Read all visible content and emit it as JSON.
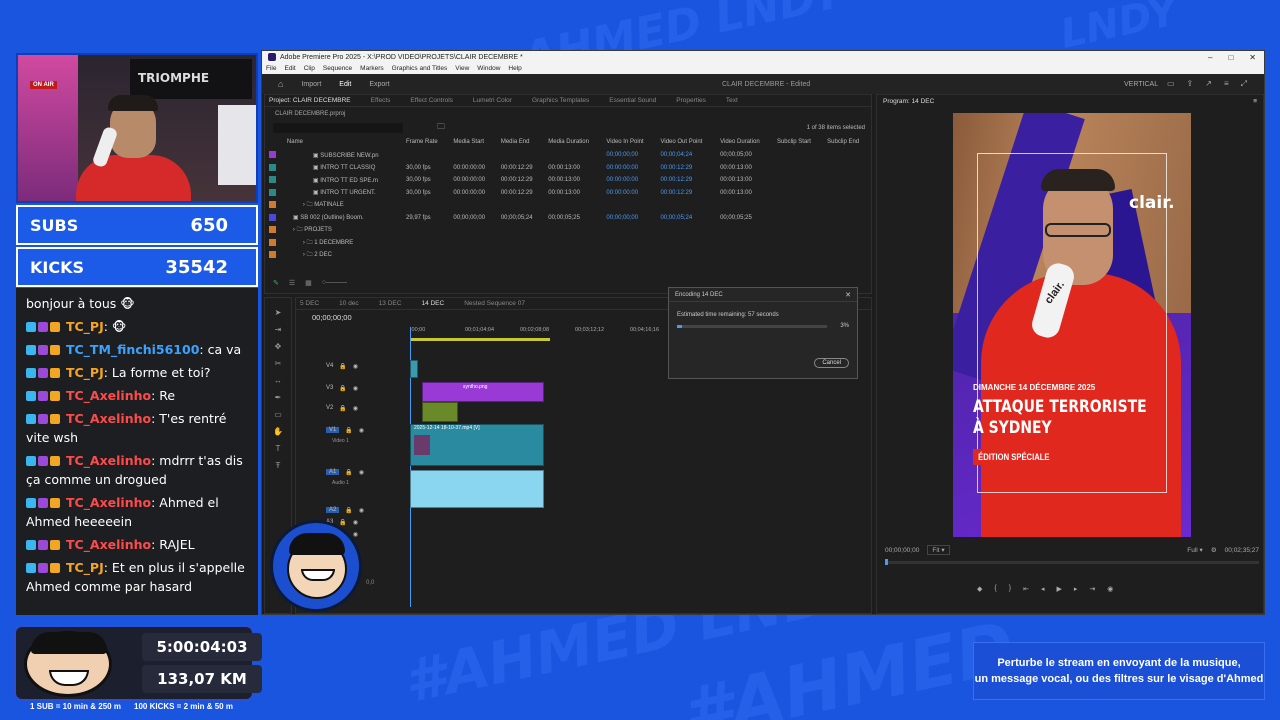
{
  "overlay": {
    "background_text": [
      "AHMED LNDY",
      "#AHMED",
      "LNDY",
      "#AHMED LNDY"
    ],
    "subs_label": "SUBS",
    "subs_value": "650",
    "kicks_label": "KICKS",
    "kicks_value": "35542",
    "timer": "5:00:04:03",
    "distance": "133,07 KM",
    "rule_subs": "1 SUB = 10 min & 250 m",
    "rule_kicks": "100 KICKS = 2 min & 50 m",
    "message_line1": "Perturbe le stream en envoyant de la musique,",
    "message_line2": "un message vocal, ou des filtres sur le visage d'Ahmed",
    "webcam_sign": "TRIOMPHE",
    "webcam_onair": "ON AIR"
  },
  "chat": [
    {
      "user": "",
      "color": "#ffffff",
      "text": "bonjour à tous 🐵",
      "badges": false
    },
    {
      "user": "TC_PJ",
      "color": "#f5a524",
      "text": ": 🐵",
      "badges": true
    },
    {
      "user": "TC_TM_finchi56100",
      "color": "#3aa3ff",
      "text": ": ca va",
      "badges": true
    },
    {
      "user": "TC_PJ",
      "color": "#f5a524",
      "text": ": La forme et toi?",
      "badges": true
    },
    {
      "user": "TC_Axelinho",
      "color": "#ff4a4a",
      "text": ": Re",
      "badges": true
    },
    {
      "user": "TC_Axelinho",
      "color": "#ff4a4a",
      "text": ": T'es rentré vite wsh",
      "badges": true
    },
    {
      "user": "TC_Axelinho",
      "color": "#ff4a4a",
      "text": ": mdrrr t'as dis ça comme un drogued",
      "badges": true
    },
    {
      "user": "TC_Axelinho",
      "color": "#ff4a4a",
      "text": ": Ahmed el Ahmed heeeeein",
      "badges": true
    },
    {
      "user": "TC_Axelinho",
      "color": "#ff4a4a",
      "text": ": RAJEL",
      "badges": true
    },
    {
      "user": "TC_PJ",
      "color": "#f5a524",
      "text": ": Et en plus il s'appelle Ahmed comme par hasard",
      "badges": true
    }
  ],
  "premiere": {
    "window_title": "Adobe Premiere Pro 2025 - X:\\PROD VIDEO\\PROJETS\\CLAIR DECEMBRE *",
    "menu": [
      "File",
      "Edit",
      "Clip",
      "Sequence",
      "Markers",
      "Graphics and Titles",
      "View",
      "Window",
      "Help"
    ],
    "workspace_tabs": [
      "Import",
      "Edit",
      "Export"
    ],
    "doc_title": "CLAIR DECEMBRE - Edited",
    "workspace_label": "VERTICAL",
    "project_tabs": [
      "Project: CLAIR DECEMBRE",
      "Effects",
      "Effect Controls",
      "Lumetri Color",
      "Graphics Templates",
      "Essential Sound",
      "Properties",
      "Text"
    ],
    "project_file": "CLAIR DECEMBRE.prproj",
    "items_selected": "1 of 38 items selected",
    "columns": [
      "Name",
      "Frame Rate",
      "Media Start",
      "Media End",
      "Media Duration",
      "Video In Point",
      "Video Out Point",
      "Video Duration",
      "Subclip Start",
      "Subclip End"
    ],
    "rows": [
      {
        "color": "#9a3ad6",
        "indent": 3,
        "name": "SUBSCRIBE NEW.pn",
        "fr": "",
        "ms": "",
        "me": "",
        "md": "",
        "vi": "00;00;00;00",
        "vo": "00;00;04;24",
        "vd": "00;00;05;00"
      },
      {
        "color": "#2a8a8a",
        "indent": 3,
        "name": "INTRO TT CLASSIQ",
        "fr": "30,00 fps",
        "ms": "00:00:00:00",
        "me": "00:00:12:29",
        "md": "00:00:13:00",
        "vi": "00:00:00:00",
        "vo": "00:00:12:29",
        "vd": "00:00:13:00"
      },
      {
        "color": "#2a8a8a",
        "indent": 3,
        "name": "INTRO TT ED SPE.m",
        "fr": "30,00 fps",
        "ms": "00:00:00:00",
        "me": "00:00:12:29",
        "md": "00:00:13:00",
        "vi": "00:00:00:00",
        "vo": "00:00:12:29",
        "vd": "00:00:13:00"
      },
      {
        "color": "#2a8a8a",
        "indent": 3,
        "name": "INTRO TT URGENT.",
        "fr": "30,00 fps",
        "ms": "00:00:00:00",
        "me": "00:00:12:29",
        "md": "00:00:13:00",
        "vi": "00:00:00:00",
        "vo": "00:00:12:29",
        "vd": "00:00:13:00"
      },
      {
        "color": "#d07a30",
        "indent": 2,
        "name": "MATINALE",
        "fr": "",
        "ms": "",
        "me": "",
        "md": "",
        "vi": "",
        "vo": "",
        "vd": ""
      },
      {
        "color": "#4a4ad6",
        "indent": 1,
        "name": "SB 002 (Outline) Boom.",
        "fr": "29,97 fps",
        "ms": "00;00;00;00",
        "me": "00;00;05;24",
        "md": "00;00;05;25",
        "vi": "00;00;00;00",
        "vo": "00;00;05;24",
        "vd": "00;00;05;25"
      },
      {
        "color": "#d07a30",
        "indent": 1,
        "name": "PROJETS",
        "fr": "",
        "ms": "",
        "me": "",
        "md": "",
        "vi": "",
        "vo": "",
        "vd": ""
      },
      {
        "color": "#d07a30",
        "indent": 2,
        "name": "1 DECEMBRE",
        "fr": "",
        "ms": "",
        "me": "",
        "md": "",
        "vi": "",
        "vo": "",
        "vd": ""
      },
      {
        "color": "#d07a30",
        "indent": 2,
        "name": "2 DEC",
        "fr": "",
        "ms": "",
        "me": "",
        "md": "",
        "vi": "",
        "vo": "",
        "vd": ""
      }
    ],
    "seq_tabs": [
      "5 DEC",
      "10 dec",
      "13 DEC",
      "14 DEC",
      "Nested Sequence 07"
    ],
    "timecode": "00;00;00;00",
    "ruler": [
      ":00;00",
      "00;01;04;04",
      "00;02;08;08",
      "00;03;12;12",
      "00;04;16;16"
    ],
    "tracks": [
      "V4",
      "V3",
      "V2",
      "V1",
      "A1",
      "A2",
      "A3",
      "A4"
    ],
    "track_names": {
      "v1": "Video 1",
      "a1": "Audio 1"
    },
    "clip_png": "syntho.png",
    "clip_mp4": "2025-12-14 18-10-37.mp4 [V]",
    "mix_value": "0,0",
    "dialog_title": "Encoding 14 DEC",
    "dialog_status": "Estimated time remaining: 57 seconds",
    "dialog_percent": "3%",
    "dialog_progress": 0.03,
    "dialog_cancel": "Cancel",
    "program_title": "Program: 14 DEC",
    "program_tc_left": "00;00;00;00",
    "program_fit": "Fit",
    "program_full": "Full",
    "program_tc_right": "00;02;35;27"
  },
  "video": {
    "brand": "clair.",
    "mic_brand": "clair.",
    "date": "DIMANCHE 14 DÉCEMBRE 2025",
    "headline1": "ATTAQUE TERRORISTE",
    "headline2": "À SYDNEY",
    "badge": "ÉDITION SPÉCIALE"
  }
}
